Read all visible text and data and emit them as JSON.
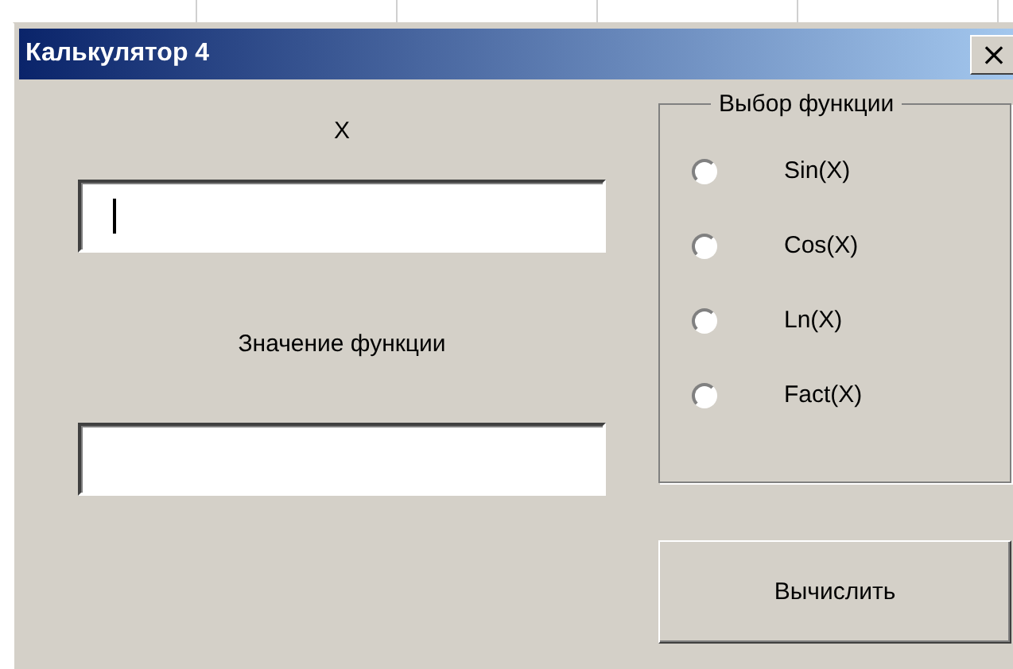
{
  "window": {
    "title": "Калькулятор 4",
    "close": "×"
  },
  "x_label": "X",
  "x_field": {
    "focused": true
  },
  "result_label": "Значение функции",
  "function_group": {
    "title": "Выбор функции",
    "options": [
      {
        "label": "Sin(X)",
        "selected": false
      },
      {
        "label": "Cos(X)",
        "selected": false
      },
      {
        "label": "Ln(X)",
        "selected": false
      },
      {
        "label": "Fact(X)",
        "selected": false
      }
    ]
  },
  "buttons": [
    "Вычислить"
  ]
}
